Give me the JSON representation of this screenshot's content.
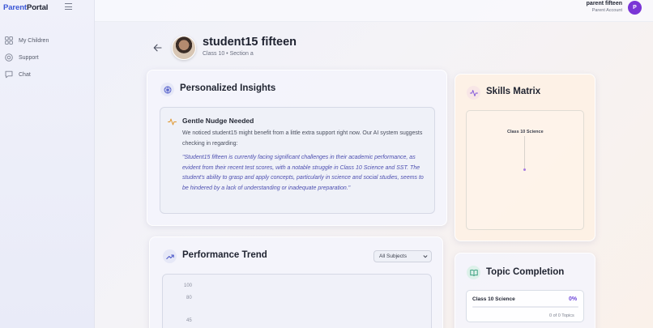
{
  "app": {
    "logo_part1": "Parent",
    "logo_part2": "Portal"
  },
  "sidebar": {
    "items": [
      {
        "label": "My Children",
        "icon": "grid-icon"
      },
      {
        "label": "Support",
        "icon": "lifebuoy-icon"
      },
      {
        "label": "Chat",
        "icon": "chat-icon"
      }
    ]
  },
  "user": {
    "name": "parent fifteen",
    "role": "Parent Account",
    "avatar_letter": "P"
  },
  "student": {
    "name": "student15 fifteen",
    "class_line": "Class 10 • Section a"
  },
  "insights": {
    "title": "Personalized Insights",
    "nudge_title": "Gentle Nudge Needed",
    "nudge_text": "We noticed student15 might benefit from a little extra support right now. Our AI system suggests checking in regarding:",
    "quote": "\"Student15 fifteen is currently facing significant challenges in their academic performance, as evident from their recent test scores, with a notable struggle in Class 10 Science and SST. The student's ability to grasp and apply concepts, particularly in science and social studies, seems to be hindered by a lack of understanding or inadequate preparation.\""
  },
  "skills": {
    "title": "Skills Matrix",
    "axis_label": "Class 10 Science"
  },
  "performance": {
    "title": "Performance Trend",
    "select_value": "All Subjects",
    "y_ticks": [
      "100",
      "80",
      "45"
    ]
  },
  "topics": {
    "title": "Topic Completion",
    "items": [
      {
        "name": "Class 10 Science",
        "percent_label": "0%",
        "progress": 0,
        "count_label": "0 of 0 Topics"
      }
    ]
  },
  "colors": {
    "accent": "#3b57d6",
    "avatar": "#7a35d6",
    "quote": "#4d4fb0",
    "progress": "#6d45d9"
  }
}
